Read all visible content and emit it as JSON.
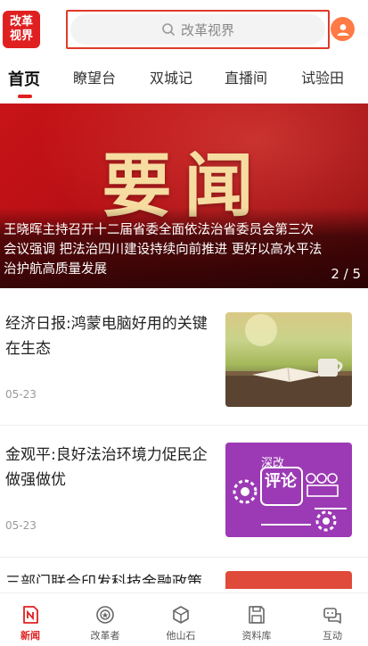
{
  "header": {
    "logo_line1": "改革",
    "logo_line2": "视界",
    "search_placeholder": "改革视界"
  },
  "tabs": [
    {
      "label": "首页",
      "active": true
    },
    {
      "label": "瞭望台",
      "active": false
    },
    {
      "label": "双城记",
      "active": false
    },
    {
      "label": "直播间",
      "active": false
    },
    {
      "label": "试验田",
      "active": false
    }
  ],
  "banner": {
    "big_text": "要闻",
    "caption": "王晓晖主持召开十二届省委全面依法治省委员会第三次会议强调 把法治四川建设持续向前推进 更好以高水平法治护航高质量发展",
    "pager": "2 / 5"
  },
  "articles": [
    {
      "title": "经济日报:鸿蒙电脑好用的关键在生态",
      "date": "05-23",
      "thumb_icon": "book-teacup-photo"
    },
    {
      "title": "金观平:良好法治环境力促民企做强做优",
      "date": "05-23",
      "thumb_icon": "shengai-pinglun-graphic",
      "thumb_text_small": "深改",
      "thumb_text_big": "评论"
    },
    {
      "title": "三部门联合印发科技金融政策",
      "date": "",
      "thumb_icon": "red-news-graphic"
    }
  ],
  "bottom_nav": [
    {
      "label": "新闻",
      "icon": "news-icon",
      "active": true
    },
    {
      "label": "改革者",
      "icon": "badge-icon",
      "active": false
    },
    {
      "label": "他山石",
      "icon": "cube-icon",
      "active": false
    },
    {
      "label": "资料库",
      "icon": "save-folder-icon",
      "active": false
    },
    {
      "label": "互动",
      "icon": "interact-icon",
      "active": false
    }
  ],
  "colors": {
    "accent": "#e02020",
    "banner_red": "#c81418",
    "banner_gold": "#f6dca0",
    "thumb_purple": "#9b3ab4"
  }
}
